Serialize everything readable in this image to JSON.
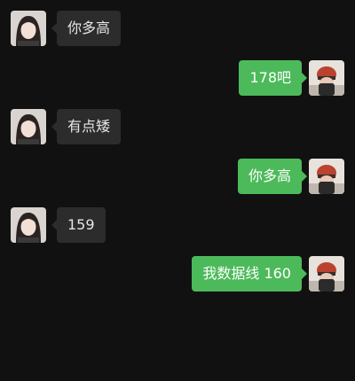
{
  "chat": {
    "messages": [
      {
        "side": "left",
        "text": "你多高"
      },
      {
        "side": "right",
        "text": "178吧"
      },
      {
        "side": "left",
        "text": "有点矮"
      },
      {
        "side": "right",
        "text": "你多高"
      },
      {
        "side": "left",
        "text": "159"
      },
      {
        "side": "right",
        "text": "我数据线 160"
      }
    ]
  },
  "colors": {
    "background": "#111111",
    "incoming_bubble": "#2c2c2c",
    "outgoing_bubble": "#4cba5a"
  }
}
